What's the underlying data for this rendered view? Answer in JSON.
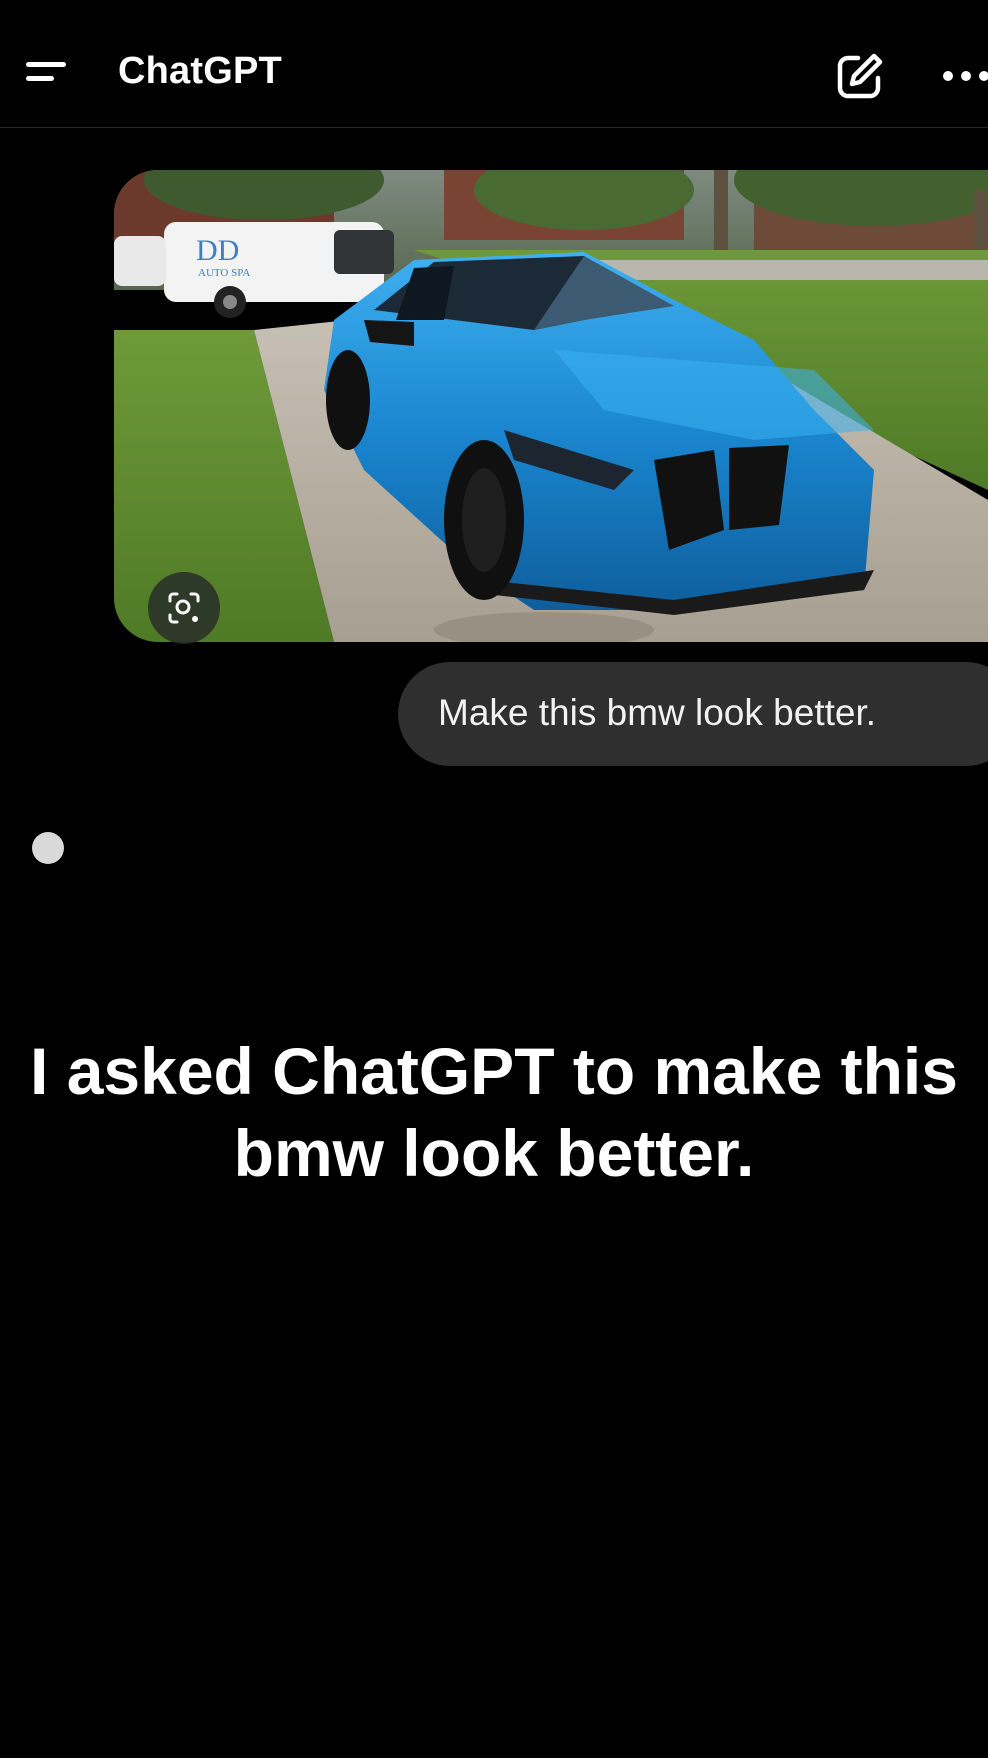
{
  "header": {
    "title": "ChatGPT",
    "menu_icon": "menu-icon",
    "new_chat_icon": "edit-icon",
    "more_icon": "ellipsis-icon"
  },
  "conversation": {
    "attachment": {
      "alt": "Blue BMW M3 parked in a driveway",
      "van_logo": "DD",
      "van_text": "AUTO SPA",
      "lens_icon": "visual-search-icon"
    },
    "user_message": "Make this bmw look better.",
    "assistant_state": "typing-indicator"
  },
  "caption": {
    "text": "I asked ChatGPT to make this bmw look better."
  },
  "colors": {
    "background": "#000000",
    "bubble": "#2f2f2f",
    "text": "#ffffff",
    "car_blue": "#1f8fd6"
  }
}
